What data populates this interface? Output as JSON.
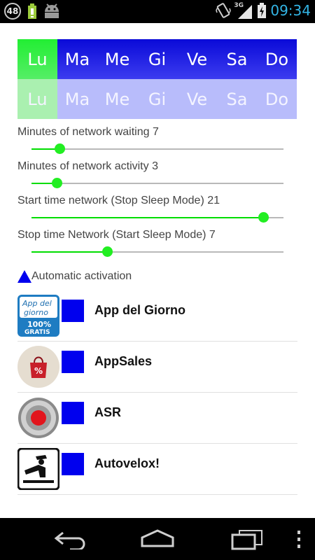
{
  "status_bar": {
    "notification_count": "48",
    "network": "3G",
    "time": "09:34"
  },
  "days": {
    "labels": [
      "Lu",
      "Ma",
      "Me",
      "Gi",
      "Ve",
      "Sa",
      "Do"
    ],
    "active": [
      true,
      false,
      false,
      false,
      false,
      false,
      false
    ]
  },
  "sliders": [
    {
      "label": "Minutes of network waiting 7",
      "level": 0.11
    },
    {
      "label": "Minutes of network activity 3",
      "level": 0.1
    },
    {
      "label": "Start time network (Stop Sleep Mode) 21",
      "level": 0.92
    },
    {
      "label": "Stop time Network (Start Sleep Mode) 7",
      "level": 0.3
    }
  ],
  "automatic_activation": {
    "label": "Automatic activation"
  },
  "apps": [
    {
      "name": "App del Giorno",
      "icon": "app-del-giorno-icon",
      "icon_text": [
        "App del",
        "giorno",
        "100%",
        "GRATIS"
      ]
    },
    {
      "name": "AppSales",
      "icon": "appsales-bag-icon"
    },
    {
      "name": "ASR",
      "icon": "record-button-icon"
    },
    {
      "name": "Autovelox!",
      "icon": "police-officer-icon"
    }
  ],
  "colors": {
    "day_active": "#33ee44",
    "day_inactive": "#1414ee",
    "slider_fill": "#00dd00",
    "checkbox": "#0000ee",
    "time": "#33b5e5"
  }
}
